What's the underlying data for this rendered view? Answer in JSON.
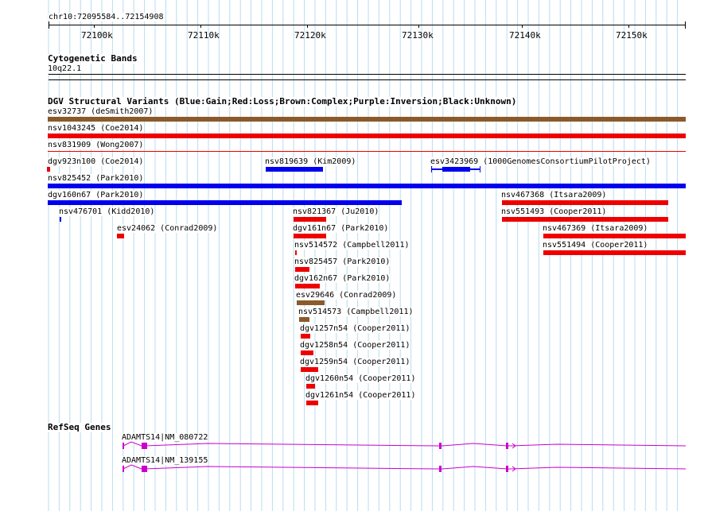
{
  "ruler": {
    "locus": "chr10:72095584..72154908",
    "ticks": [
      "72100k",
      "72110k",
      "72120k",
      "72130k",
      "72140k",
      "72150k"
    ]
  },
  "cyto": {
    "title": "Cytogenetic Bands",
    "band": "10q22.1"
  },
  "dgv": {
    "title": "DGV Structural Variants (Blue:Gain;Red:Loss;Brown:Complex;Purple:Inversion;Black:Unknown)",
    "colors": {
      "gain": "#0000ee",
      "loss": "#ee0000",
      "complex": "#8b5a2b"
    },
    "features": [
      {
        "label": "esv32737 (deSmith2007)",
        "type": "complex"
      },
      {
        "label": "nsv1043245 (Coe2014)",
        "type": "loss"
      },
      {
        "label": "nsv831909 (Wong2007)",
        "type": "loss"
      },
      {
        "label": "dgv923n100 (Coe2014)",
        "type": "loss"
      },
      {
        "label": "nsv819639 (Kim2009)",
        "type": "gain"
      },
      {
        "label": "esv3423969 (1000GenomesConsortiumPilotProject)",
        "type": "gain"
      },
      {
        "label": "nsv825452 (Park2010)",
        "type": "gain"
      },
      {
        "label": "dgv160n67 (Park2010)",
        "type": "gain"
      },
      {
        "label": "nsv467368 (Itsara2009)",
        "type": "loss"
      },
      {
        "label": "nsv476701 (Kidd2010)",
        "type": "gain"
      },
      {
        "label": "nsv821367 (Ju2010)",
        "type": "loss"
      },
      {
        "label": "nsv551493 (Cooper2011)",
        "type": "loss"
      },
      {
        "label": "esv24062 (Conrad2009)",
        "type": "loss"
      },
      {
        "label": "dgv161n67 (Park2010)",
        "type": "loss"
      },
      {
        "label": "nsv467369 (Itsara2009)",
        "type": "loss"
      },
      {
        "label": "nsv514572 (Campbell2011)",
        "type": "loss"
      },
      {
        "label": "nsv551494 (Cooper2011)",
        "type": "loss"
      },
      {
        "label": "nsv825457 (Park2010)",
        "type": "loss"
      },
      {
        "label": "dgv162n67 (Park2010)",
        "type": "loss"
      },
      {
        "label": "esv29646 (Conrad2009)",
        "type": "complex"
      },
      {
        "label": "nsv514573 (Campbell2011)",
        "type": "complex"
      },
      {
        "label": "dgv1257n54 (Cooper2011)",
        "type": "loss"
      },
      {
        "label": "dgv1258n54 (Cooper2011)",
        "type": "loss"
      },
      {
        "label": "dgv1259n54 (Cooper2011)",
        "type": "loss"
      },
      {
        "label": "dgv1260n54 (Cooper2011)",
        "type": "loss"
      },
      {
        "label": "dgv1261n54 (Cooper2011)",
        "type": "loss"
      }
    ]
  },
  "genes": {
    "title": "RefSeq Genes",
    "color": "#cc00cc",
    "items": [
      {
        "label": "ADAMTS14|NM_080722"
      },
      {
        "label": "ADAMTS14|NM_139155"
      }
    ]
  }
}
